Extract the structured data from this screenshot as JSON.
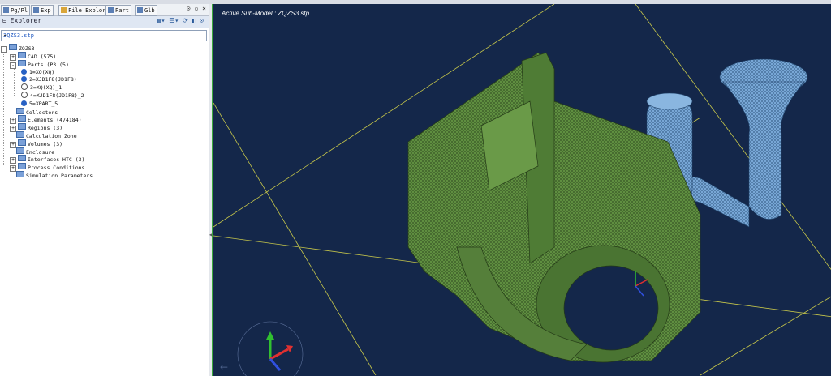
{
  "tabs": [
    {
      "label": "Pg/Pl",
      "icon": "pages-icon"
    },
    {
      "label": "Exp",
      "icon": "explorer-icon"
    },
    {
      "label": "File Explorer",
      "icon": "folder-icon"
    },
    {
      "label": "Part",
      "icon": "part-icon"
    },
    {
      "label": "Glb",
      "icon": "globe-icon"
    }
  ],
  "explorer": {
    "title": "Explorer",
    "combo_value": "ZQZS3.stp",
    "root": "ZQZS3",
    "items": [
      {
        "label": "CAD (575)",
        "level": 1,
        "expander": "+",
        "kind": "folder"
      },
      {
        "label": "Parts (P3 (5)",
        "level": 1,
        "expander": "-",
        "kind": "folder"
      },
      {
        "label": "1=XQ(XQ)",
        "level": 2,
        "kind": "dot"
      },
      {
        "label": "2=XJD1F8(JD1F8)",
        "level": 2,
        "kind": "dot"
      },
      {
        "label": "3=XQ(XQ)_1",
        "level": 2,
        "kind": "empty"
      },
      {
        "label": "4=XJD1F8(JD1F8)_2",
        "level": 2,
        "kind": "empty"
      },
      {
        "label": "5=XPART_5",
        "level": 2,
        "kind": "dot"
      },
      {
        "label": "Collectors",
        "level": 1,
        "expander": "",
        "kind": "folder"
      },
      {
        "label": "Elements (474184)",
        "level": 1,
        "expander": "+",
        "kind": "folder"
      },
      {
        "label": "Regions (3)",
        "level": 1,
        "expander": "+",
        "kind": "folder"
      },
      {
        "label": "Calculation Zone",
        "level": 1,
        "expander": "",
        "kind": "folder"
      },
      {
        "label": "Volumes (3)",
        "level": 1,
        "expander": "+",
        "kind": "folder"
      },
      {
        "label": "Enclosure",
        "level": 1,
        "expander": "",
        "kind": "folder"
      },
      {
        "label": "Interfaces HTC (3)",
        "level": 1,
        "expander": "+",
        "kind": "folder"
      },
      {
        "label": "Process Conditions",
        "level": 1,
        "expander": "+",
        "kind": "folder"
      },
      {
        "label": "Simulation Parameters",
        "level": 1,
        "expander": "",
        "kind": "folder"
      }
    ]
  },
  "viewport": {
    "title": "Active Sub-Model : ZQZS3.stp",
    "background": "#14274a",
    "casting_color": "#5a8a3c",
    "gating_color": "#6f9fcf",
    "grid_color": "#c8c84a"
  },
  "colors": {
    "accent": "#2761c4",
    "viewport_border": "#3aa83a"
  }
}
